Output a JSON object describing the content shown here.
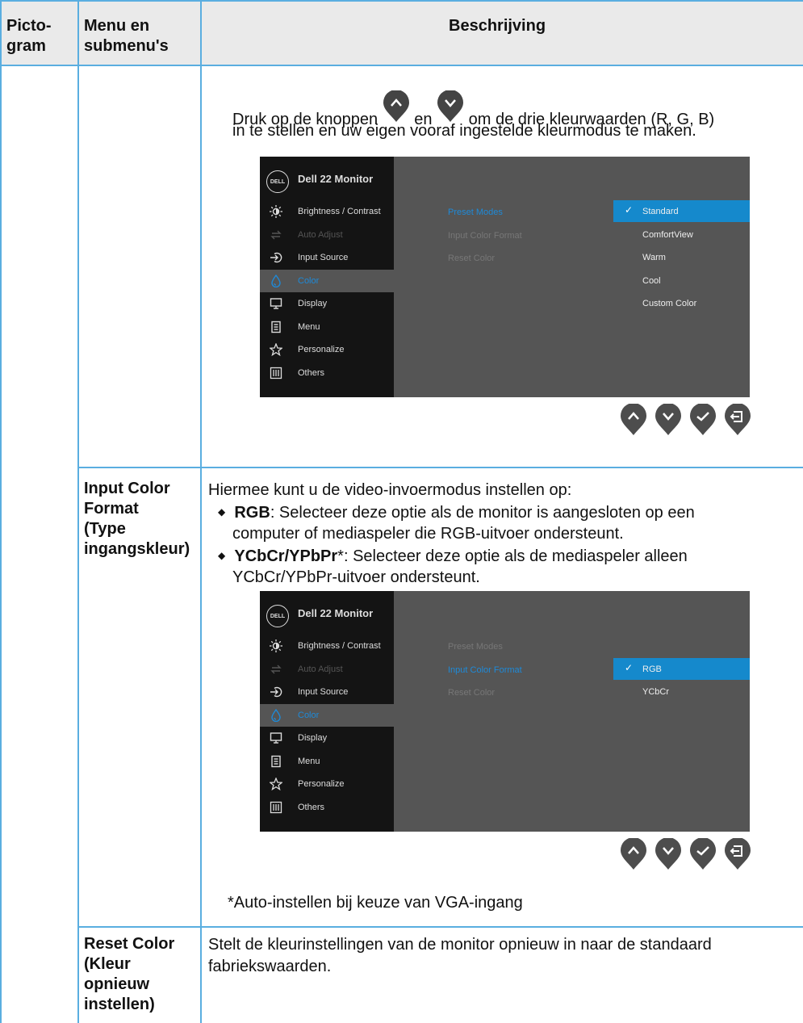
{
  "header": {
    "col1": "Picto-\ngram",
    "col2": "Menu en\nsubmenu's",
    "col3": "Beschrijving"
  },
  "row1": {
    "text_before": "Druk op de knoppen",
    "text_en": "en",
    "text_after": "om de drie kleurwaarden (R, G, B)",
    "text_line2": "in te stellen en uw eigen vooraf ingestelde kleurmodus te maken."
  },
  "osd_common": {
    "logo": "DELL",
    "title": "Dell 22 Monitor",
    "menu": [
      {
        "label": "Brightness / Contrast",
        "icon": "brightness-icon"
      },
      {
        "label": "Auto Adjust",
        "icon": "auto-adjust-icon"
      },
      {
        "label": "Input Source",
        "icon": "input-source-icon"
      },
      {
        "label": "Color",
        "icon": "color-icon"
      },
      {
        "label": "Display",
        "icon": "display-icon"
      },
      {
        "label": "Menu",
        "icon": "menu-icon"
      },
      {
        "label": "Personalize",
        "icon": "star-icon"
      },
      {
        "label": "Others",
        "icon": "others-icon"
      }
    ],
    "submenu": [
      "Preset Modes",
      "Input Color Format",
      "Reset Color"
    ]
  },
  "osd1": {
    "active_submenu": "Preset Modes",
    "options": [
      "Standard",
      "ComfortView",
      "Warm",
      "Cool",
      "Custom Color"
    ],
    "selected_option": "Standard"
  },
  "osd2": {
    "active_submenu": "Input Color Format",
    "options": [
      "RGB",
      "YCbCr"
    ],
    "selected_option": "RGB"
  },
  "row2": {
    "label": "Input Color\nFormat\n(Type\ningangskleur)",
    "intro": "Hiermee kunt u de video-invoermodus instellen op:",
    "b1_term": "RGB",
    "b1_text": ": Selecteer deze optie als de monitor is aangesloten op een",
    "b1_text2": "computer of mediaspeler die RGB-uitvoer ondersteunt.",
    "b2_term": "YCbCr/YPbPr",
    "b2_star": "*",
    "b2_text": ": Selecteer deze optie als de mediaspeler alleen",
    "b2_text2": "YCbCr/YPbPr-uitvoer ondersteunt.",
    "footnote": "*Auto-instellen bij keuze van VGA-ingang"
  },
  "row3": {
    "label": "Reset Color\n(Kleur\nopnieuw\ninstellen)",
    "text": "Stelt de kleurinstellingen van de monitor opnieuw in naar de standaard",
    "text2": "fabriekswaarden."
  },
  "colors": {
    "border": "#5aaee0",
    "header_bg": "#eaeaea",
    "osd_accent": "#1589cc",
    "button": "#4d4d4d"
  }
}
